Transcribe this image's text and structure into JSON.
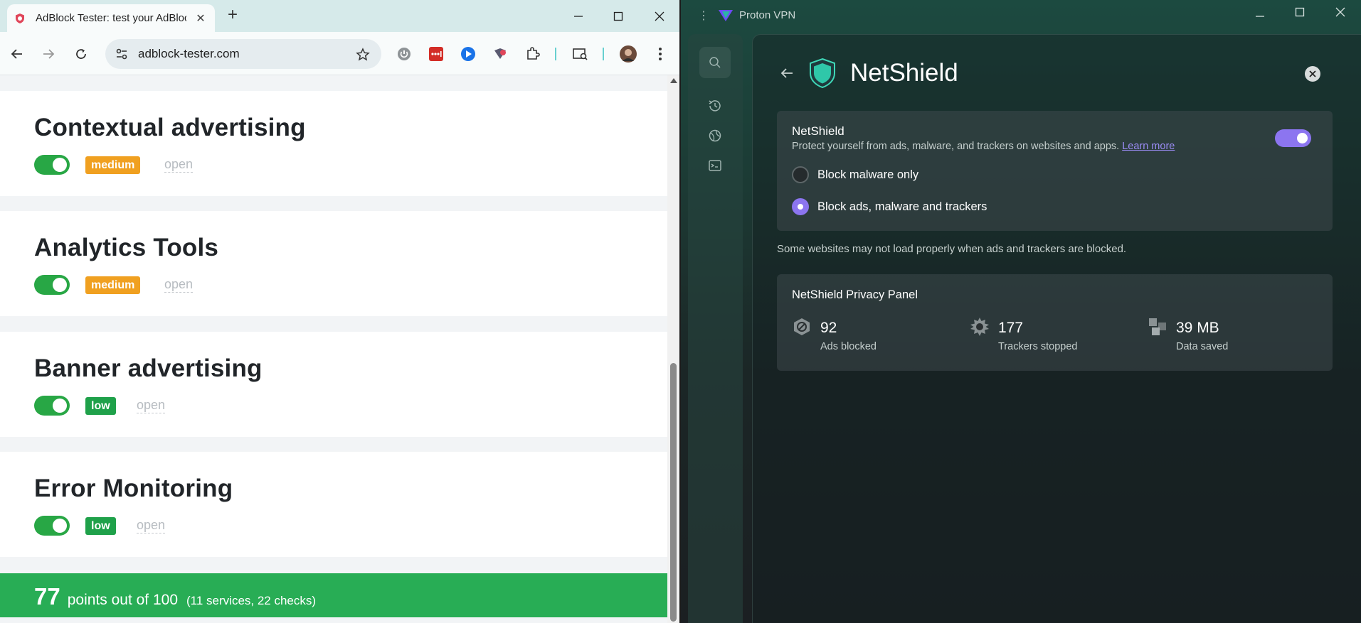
{
  "browser": {
    "tab": {
      "title": "AdBlock Tester: test your AdBlock",
      "favicon": "shield-icon"
    },
    "url": "adblock-tester.com",
    "toolbar_icons": [
      "back-icon",
      "forward-icon",
      "reload-icon",
      "site-settings-icon",
      "bookmark-star-icon",
      "ext-power-icon",
      "ext-lastpass-icon",
      "ext-messenger-icon",
      "ext-privacy-icon",
      "extensions-puzzle-icon",
      "tab-search-icon",
      "profile-avatar",
      "menu-kebab-icon"
    ]
  },
  "page": {
    "cards": [
      {
        "title": "Contextual advertising",
        "level": "medium",
        "link": "open"
      },
      {
        "title": "Analytics Tools",
        "level": "medium",
        "link": "open"
      },
      {
        "title": "Banner advertising",
        "level": "low",
        "link": "open"
      },
      {
        "title": "Error Monitoring",
        "level": "low",
        "link": "open"
      }
    ],
    "score": {
      "points": "77",
      "text": "points out of 100",
      "detail": "(11 services, 22 checks)"
    }
  },
  "vpn": {
    "app_title": "Proton VPN",
    "panel_title": "NetShield",
    "netshield": {
      "name": "NetShield",
      "description": "Protect yourself from ads, malware, and trackers on websites and apps.",
      "learn_more": "Learn more",
      "enabled": true,
      "options": [
        {
          "label": "Block malware only",
          "selected": false
        },
        {
          "label": "Block ads, malware and trackers",
          "selected": true
        }
      ]
    },
    "note": "Some websites may not load properly when ads and trackers are blocked.",
    "privacy_panel": {
      "title": "NetShield Privacy Panel",
      "stats": [
        {
          "value": "92",
          "label": "Ads blocked",
          "icon": "ad-block-icon"
        },
        {
          "value": "177",
          "label": "Trackers stopped",
          "icon": "tracker-icon"
        },
        {
          "value": "39 MB",
          "label": "Data saved",
          "icon": "data-icon"
        }
      ]
    },
    "colors": {
      "accent": "#8c75f0",
      "green": "#28ad55",
      "medium": "#f0a020"
    }
  }
}
